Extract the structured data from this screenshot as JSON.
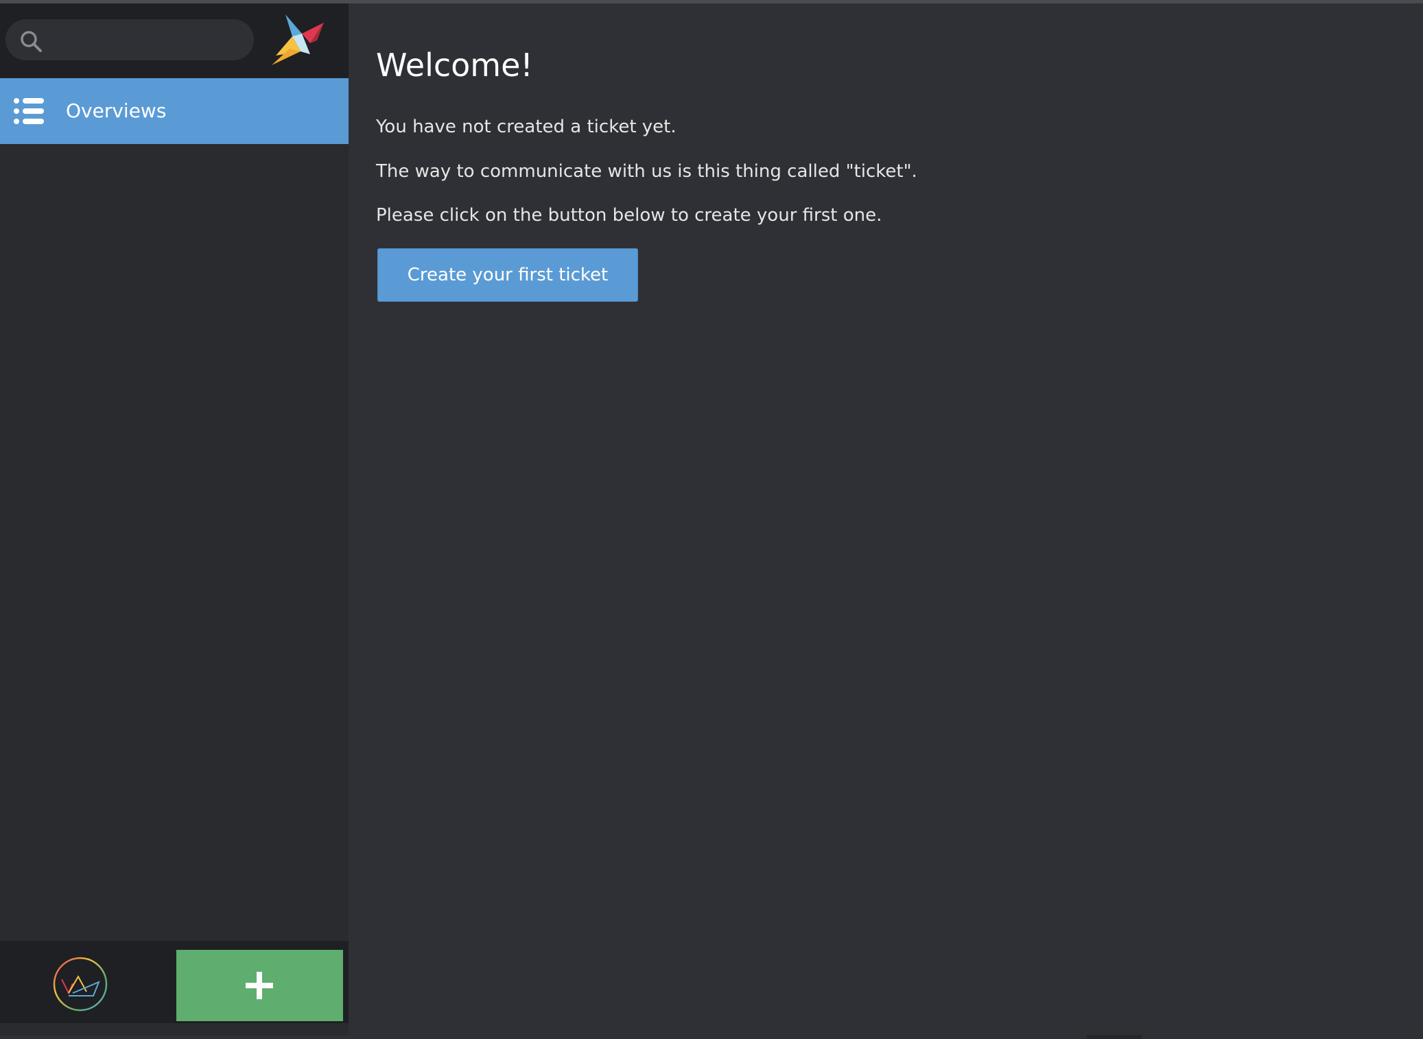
{
  "sidebar": {
    "search": {
      "placeholder": "",
      "icon": "search-icon"
    },
    "logo": "bird-logo",
    "nav": [
      {
        "label": "Overviews",
        "icon": "list-icon",
        "active": true
      }
    ],
    "bottom": {
      "avatar": "crown-avatar",
      "add_icon": "plus-icon"
    }
  },
  "main": {
    "title": "Welcome!",
    "paragraphs": [
      "You have not created a ticket yet.",
      "The way to communicate with us is this thing called \"ticket\".",
      "Please click on the button below to create your first one."
    ],
    "cta_label": "Create your first ticket"
  },
  "colors": {
    "accent": "#5b9bd5",
    "add_button": "#5fae6f",
    "sidebar_bg": "#2a2b2f",
    "main_bg": "#2e3035"
  }
}
